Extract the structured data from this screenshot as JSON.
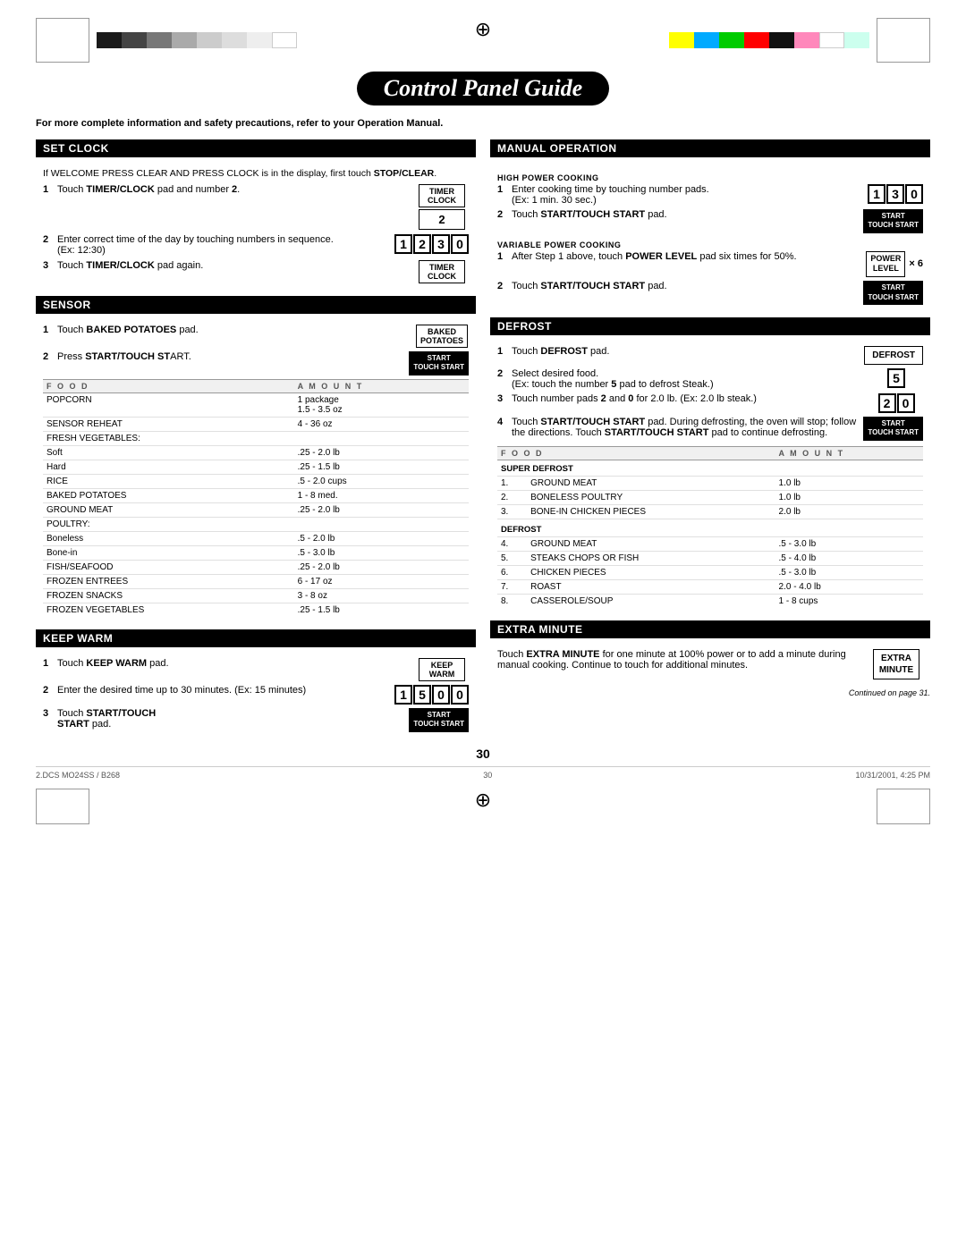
{
  "colorBar": {
    "left": [
      "#1a1a1a",
      "#444444",
      "#777777",
      "#aaaaaa",
      "#cccccc",
      "#e0e0e0",
      "#f5f5f5",
      "#ffffff"
    ],
    "right": [
      "#ffff00",
      "#00aaff",
      "#00cc00",
      "#ff0000",
      "#000000",
      "#ff99cc",
      "#ffffff",
      "#ccffff"
    ]
  },
  "title": "Control Panel Guide",
  "subtitle": "For more complete information and safety precautions, refer to your Operation Manual.",
  "sections": {
    "setClock": {
      "header": "SET CLOCK",
      "intro": "If WELCOME PRESS CLEAR AND PRESS CLOCK is in the display, first touch STOP/CLEAR.",
      "steps": [
        {
          "num": "1",
          "text": "Touch TIMER/CLOCK pad and number 2.",
          "pad1": "TIMER\nCLOCK",
          "pad2": "2"
        },
        {
          "num": "2",
          "text": "Enter correct time of the day by touching numbers in sequence. (Ex: 12:30)",
          "display": "1230"
        },
        {
          "num": "3",
          "text": "Touch TIMER/CLOCK pad again.",
          "pad1": "TIMER\nCLOCK"
        }
      ]
    },
    "sensor": {
      "header": "SENSOR",
      "steps": [
        {
          "num": "1",
          "text": "Touch BAKED POTATOES pad.",
          "pad": "BAKED\nPOTATOES"
        },
        {
          "num": "2",
          "text": "Press START/TOUCH START.",
          "pad": "START\nTOUCH START"
        }
      ],
      "tableHeaders": [
        "FOOD",
        "AMOUNT"
      ],
      "tableRows": [
        {
          "food": "POPCORN",
          "amount": "1 package\n1.5 - 3.5 oz"
        },
        {
          "food": "SENSOR REHEAT",
          "amount": "4 - 36 oz"
        },
        {
          "food": "FRESH  VEGETABLES:",
          "amount": ""
        },
        {
          "food": "  Soft",
          "amount": ".25 - 2.0 lb"
        },
        {
          "food": "  Hard",
          "amount": ".25 - 1.5 lb"
        },
        {
          "food": "RICE",
          "amount": ".5 - 2.0 cups"
        },
        {
          "food": "BAKED POTATOES",
          "amount": "1 - 8 med."
        },
        {
          "food": "GROUND MEAT",
          "amount": ".25 - 2.0 lb"
        },
        {
          "food": "POULTRY:",
          "amount": ""
        },
        {
          "food": "  Boneless",
          "amount": ".5 - 2.0 lb"
        },
        {
          "food": "  Bone-in",
          "amount": ".5 - 3.0 lb"
        },
        {
          "food": "FISH/SEAFOOD",
          "amount": ".25 - 2.0 lb"
        },
        {
          "food": "FROZEN ENTREES",
          "amount": "6 - 17 oz"
        },
        {
          "food": "FROZEN SNACKS",
          "amount": "3 - 8 oz"
        },
        {
          "food": "FROZEN VEGETABLES",
          "amount": ".25 - 1.5 lb"
        }
      ]
    },
    "keepWarm": {
      "header": "KEEP WARM",
      "steps": [
        {
          "num": "1",
          "text": "Touch KEEP WARM pad.",
          "pad": "KEEP\nWARM"
        },
        {
          "num": "2",
          "text": "Enter the desired time up to 30 minutes. (Ex: 15 minutes)",
          "display": "1500"
        },
        {
          "num": "3",
          "text": "Touch START/TOUCH\nSTART pad.",
          "pad": "START\nTOUCH START"
        }
      ]
    },
    "manualOperation": {
      "header": "MANUAL OPERATION",
      "highPower": {
        "label": "HIGH POWER COOKING",
        "steps": [
          {
            "num": "1",
            "text": "Enter cooking time by touching number pads. (Ex: 1 min. 30 sec.)",
            "display": "130"
          },
          {
            "num": "2",
            "text": "Touch START/TOUCH START pad.",
            "pad": "START\nTOUCH START"
          }
        ]
      },
      "variablePower": {
        "label": "VARIABLE POWER COOKING",
        "steps": [
          {
            "num": "1",
            "text": "After Step 1 above, touch POWER LEVEL pad six times for 50%.",
            "pad1": "POWER\nLEVEL",
            "times": "x 6"
          },
          {
            "num": "2",
            "text": "Touch START/TOUCH START pad.",
            "pad": "START\nTOUCH START"
          }
        ]
      }
    },
    "defrost": {
      "header": "DEFROST",
      "steps": [
        {
          "num": "1",
          "text": "Touch DEFROST pad.",
          "pad": "DEFROST"
        },
        {
          "num": "2",
          "text": "Select desired food. (Ex: touch the number 5 pad to defrost Steak.)",
          "display": "5"
        },
        {
          "num": "3",
          "text": "Touch number pads 2 and 0 for 2.0 lb. (Ex: 2.0 lb steak.)",
          "display": "20"
        },
        {
          "num": "4",
          "text": "Touch START/TOUCH START pad. During defrosting, the oven will stop; follow the directions. Touch START/TOUCH START pad to continue defrosting.",
          "pad": "START\nTOUCH START"
        }
      ],
      "tableHeaders": [
        "FOOD",
        "AMOUNT"
      ],
      "superDefrostLabel": "SUPER DEFROST",
      "superDefrostRows": [
        {
          "num": "1.",
          "food": "GROUND MEAT",
          "amount": "1.0 lb"
        },
        {
          "num": "2.",
          "food": "BONELESS POULTRY",
          "amount": "1.0 lb"
        },
        {
          "num": "3.",
          "food": "BONE-IN CHICKEN PIECES",
          "amount": "2.0 lb"
        }
      ],
      "defrostLabel": "DEFROST",
      "defrostRows": [
        {
          "num": "4.",
          "food": "GROUND MEAT",
          "amount": ".5 - 3.0 lb"
        },
        {
          "num": "5.",
          "food": "STEAKS CHOPS OR FISH",
          "amount": ".5 - 4.0 lb"
        },
        {
          "num": "6.",
          "food": "CHICKEN PIECES",
          "amount": ".5 - 3.0 lb"
        },
        {
          "num": "7.",
          "food": "ROAST",
          "amount": "2.0 - 4.0 lb"
        },
        {
          "num": "8.",
          "food": "CASSEROLE/SOUP",
          "amount": "1 - 8 cups"
        }
      ]
    },
    "extraMinute": {
      "header": "EXTRA MINUTE",
      "text": "Touch EXTRA MINUTE for one minute at 100% power or to add a minute during manual cooking. Continue to touch for additional minutes.",
      "pad": "EXTRA\nMINUTE"
    }
  },
  "pageNumber": "30",
  "continued": "Continued on page 31.",
  "footer": {
    "left": "2.DCS MO24SS / B268",
    "center": "30",
    "right": "10/31/2001, 4:25 PM"
  }
}
